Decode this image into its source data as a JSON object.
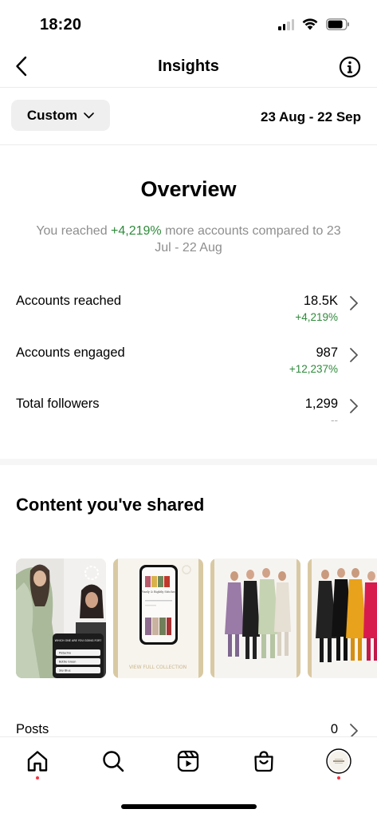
{
  "status_bar": {
    "time": "18:20"
  },
  "nav": {
    "title": "Insights"
  },
  "filter": {
    "custom_label": "Custom",
    "date_range": "23 Aug - 22 Sep"
  },
  "overview": {
    "title": "Overview",
    "sub_prefix": "You reached ",
    "sub_highlight": "+4,219%",
    "sub_suffix": " more accounts compared to 23 Jul - 22 Aug"
  },
  "metrics": [
    {
      "label": "Accounts reached",
      "value": "18.5K",
      "change": "+4,219%"
    },
    {
      "label": "Accounts engaged",
      "value": "987",
      "change": "+12,237%"
    },
    {
      "label": "Total followers",
      "value": "1,299",
      "change": "--"
    }
  ],
  "content": {
    "title": "Content you've shared",
    "thumb_texts": {
      "poll_question": "WHICH ONE ARE YOU GOING FOR?",
      "poll_options": [
        "Pistachio",
        "Bottle Green",
        "Sky Blue"
      ],
      "collection_heading": "Finely & Rightly Stitched",
      "view_collection": "VIEW FULL COLLECTION"
    }
  },
  "posts": {
    "label": "Posts",
    "value": "0"
  },
  "colors": {
    "green": "#2e8b3a",
    "notification_dot": "#ff3040"
  },
  "icons": [
    "back-arrow-icon",
    "info-icon",
    "chevron-down-icon",
    "chevron-right-icon",
    "home-icon",
    "search-icon",
    "reels-icon",
    "shop-icon",
    "profile-avatar"
  ]
}
